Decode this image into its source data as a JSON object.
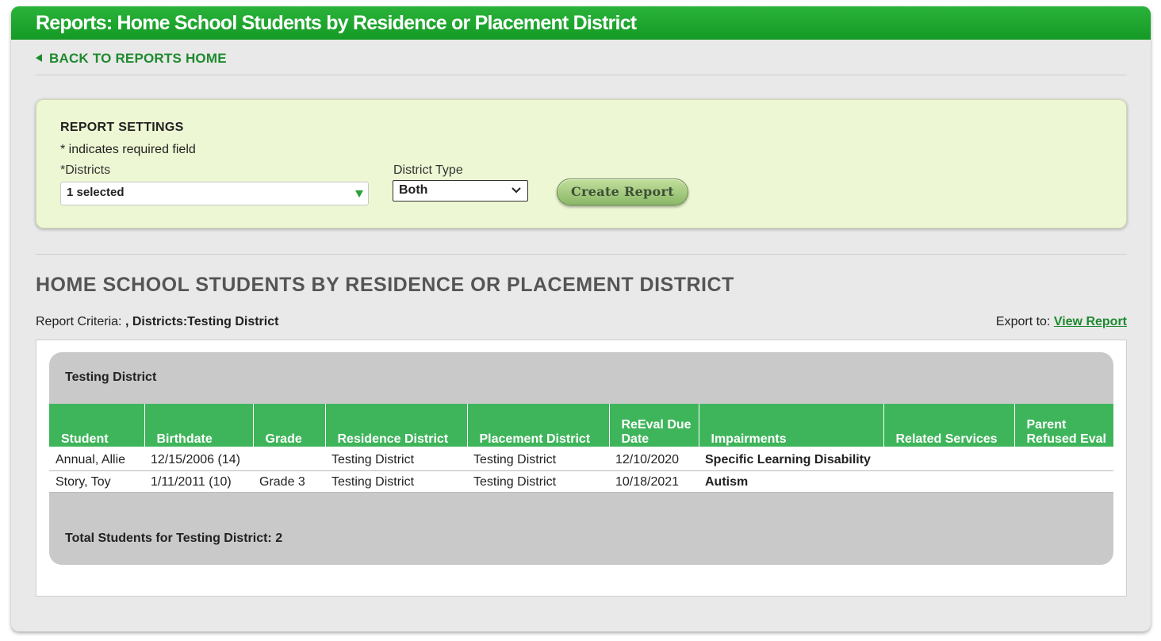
{
  "page": {
    "title": "Reports: Home School Students by Residence or Placement District",
    "back_link": "BACK TO REPORTS HOME"
  },
  "settings": {
    "heading": "REPORT SETTINGS",
    "required_note": "* indicates required field",
    "districts_required_mark": "*",
    "districts_label": "Districts",
    "districts_value": "1 selected",
    "district_type_label": "District Type",
    "district_type_value": "Both",
    "create_button": "Create Report"
  },
  "report": {
    "title": "HOME SCHOOL STUDENTS BY RESIDENCE OR PLACEMENT DISTRICT",
    "criteria_label": "Report Criteria:",
    "criteria_value": ", Districts:Testing District",
    "export_label": "Export to:",
    "export_link": "View Report",
    "group_name": "Testing District",
    "columns": [
      "Student",
      "Birthdate",
      "Grade",
      "Residence District",
      "Placement District",
      "ReEval Due Date",
      "Impairments",
      "Related Services",
      "Parent Refused Eval"
    ],
    "rows": [
      {
        "student": "Annual, Allie",
        "birthdate": "12/15/2006 (14)",
        "grade": "",
        "residence": "Testing District",
        "placement": "Testing District",
        "reeval": "12/10/2020",
        "impairments": "Specific Learning Disability",
        "related": "",
        "refused": ""
      },
      {
        "student": "Story, Toy",
        "birthdate": "1/11/2011 (10)",
        "grade": "Grade 3",
        "residence": "Testing District",
        "placement": "Testing District",
        "reeval": "10/18/2021",
        "impairments": "Autism",
        "related": "",
        "refused": ""
      }
    ],
    "total": "Total Students for Testing District: 2"
  },
  "colors": {
    "title_bar": "#149a25",
    "accent_green": "#1e8a2e",
    "table_header": "#3fb55b",
    "settings_bg": "#edf7d3"
  }
}
